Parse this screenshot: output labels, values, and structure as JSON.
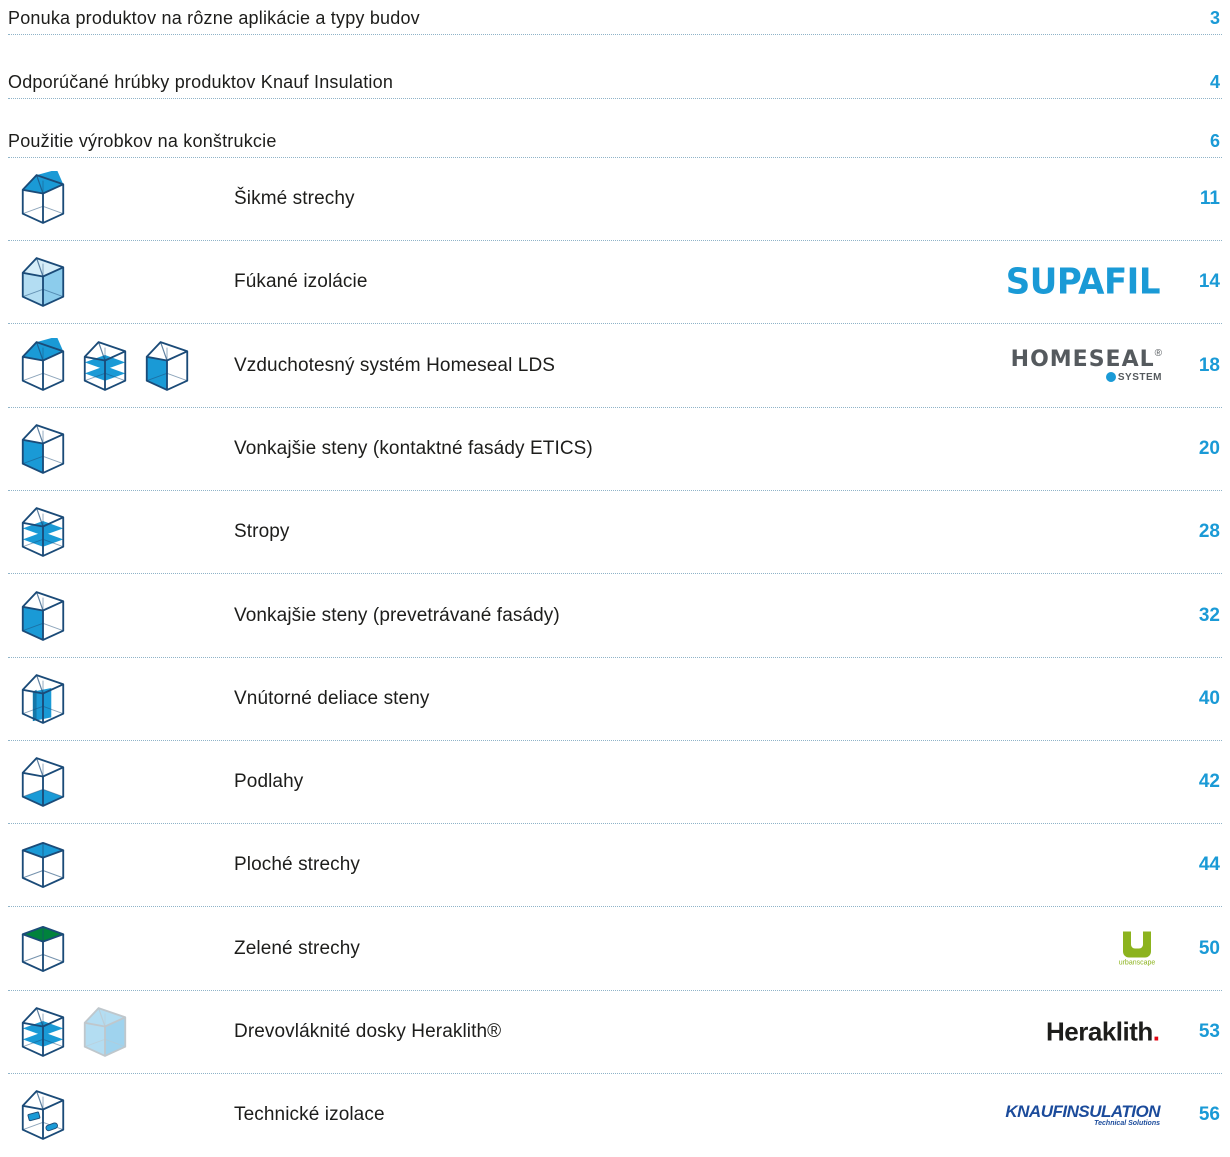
{
  "top_entries": [
    {
      "title": "Ponuka produktov na rôzne aplikácie a typy budov",
      "page": "3"
    },
    {
      "title": "Odporúčané hrúbky produktov Knauf Insulation",
      "page": "4"
    },
    {
      "title": "Použitie výrobkov na konštrukcie",
      "page": "6"
    }
  ],
  "sections": [
    {
      "title": "Šikmé strechy",
      "page": "11",
      "icons": [
        "house-pitched-roof-icon"
      ]
    },
    {
      "title": "Fúkané izolácie",
      "page": "14",
      "icons": [
        "house-blown-insulation-icon"
      ],
      "logo": {
        "text": "SUPAFIL",
        "color": "#1a9ad6"
      }
    },
    {
      "title": "Vzduchotesný systém Homeseal LDS",
      "page": "18",
      "icons": [
        "house-pitched-roof-icon",
        "house-floors-icon",
        "house-wall-icon"
      ],
      "logo": {
        "text": "HOMESEAL",
        "sub": "SYSTEM",
        "tm": "®"
      }
    },
    {
      "title": "Vonkajšie steny (kontaktné fasády ETICS)",
      "page": "20",
      "icons": [
        "house-wall-icon"
      ]
    },
    {
      "title": "Stropy",
      "page": "28",
      "icons": [
        "house-floors-icon"
      ]
    },
    {
      "title": "Vonkajšie steny (prevetrávané fasády)",
      "page": "32",
      "icons": [
        "house-wall-icon"
      ]
    },
    {
      "title": "Vnútorné deliace steny",
      "page": "40",
      "icons": [
        "house-partition-icon"
      ]
    },
    {
      "title": "Podlahy",
      "page": "42",
      "icons": [
        "house-ground-floor-icon"
      ]
    },
    {
      "title": "Ploché strechy",
      "page": "44",
      "icons": [
        "box-flat-roof-icon"
      ]
    },
    {
      "title": "Zelené strechy",
      "page": "50",
      "icons": [
        "box-green-roof-icon"
      ],
      "logo": {
        "text": "urbanscape"
      }
    },
    {
      "title": "Drevovláknité dosky Heraklith®",
      "page": "53",
      "icons": [
        "house-floors-icon",
        "house-light-icon"
      ],
      "logo": {
        "text": "Heraklith",
        "dot": "."
      }
    },
    {
      "title": "Technické izolace",
      "page": "56",
      "icons": [
        "house-technical-icon"
      ],
      "logo": {
        "text": "KNAUFINSULATION",
        "sub": "Technical Solutions"
      }
    }
  ],
  "colors": {
    "accent": "#1a9ad6",
    "light_blue": "#b3ddf2",
    "green": "#00823c",
    "urbanscape_green": "#8cb31e",
    "dark_blue": "#1b4b78"
  }
}
